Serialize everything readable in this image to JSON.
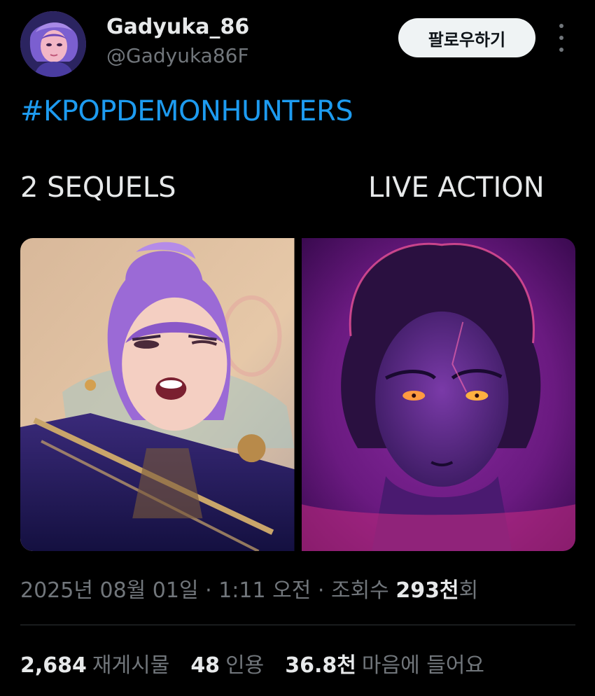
{
  "user": {
    "display_name": "Gadyuka_86",
    "handle": "@Gadyuka86F",
    "follow_label": "팔로우하기"
  },
  "post": {
    "hashtag": "#KPOPDEMONHUNTERS",
    "text_left": "2 SEQUELS",
    "text_right": "LIVE ACTION",
    "date": "2025년 08월 01일",
    "time": "1:11 오전",
    "separator": "·",
    "views_label_prefix": "조회수",
    "views_count": "293천",
    "views_label_suffix": "회"
  },
  "stats": {
    "reposts_count": "2,684",
    "reposts_label": "재게시물",
    "quotes_count": "48",
    "quotes_label": "인용",
    "likes_count": "36.8천",
    "likes_label": "마음에 들어요"
  },
  "colors": {
    "background": "#000000",
    "link": "#1d9bf0",
    "secondary_text": "#71767b",
    "primary_text": "#e7e9ea",
    "button_bg": "#eff3f4"
  },
  "icons": {
    "more": "more-vertical-icon"
  }
}
